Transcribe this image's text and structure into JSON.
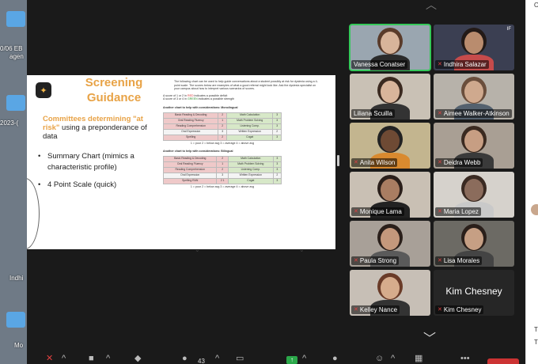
{
  "desktop": {
    "items": [
      {
        "label": "0/06 EB"
      },
      {
        "label": "agen"
      },
      {
        "label": "2023-("
      },
      {
        "label": "Indhi"
      },
      {
        "label": "Mo"
      }
    ]
  },
  "slide": {
    "title": "Screening Guidance",
    "subtitle_highlight": "Committees determining \"at risk\"",
    "subtitle_rest": " using a preponderance of data",
    "bullets": [
      "Summary Chart (mimics a characteristic profile)",
      "4 Point Scale (quick)"
    ],
    "intro": "The following chart can be used to help guide conversations about a student possibly at risk for dyslexia using a 4-point scale. The scores below are examples of what a good referral might look like. Ask the dyslexia specialist on your campus about how to interpret various scenarios of scores.",
    "deficit_prefix": "A score of 1 or 2 in ",
    "deficit_color_word": "RED",
    "deficit_suffix": " indicates a possible deficit",
    "strength_prefix": "A score of 3 or 4 in ",
    "strength_color_word": "GREEN",
    "strength_suffix": " indicates a possible strength",
    "table1_heading": "Another chart to help with considerations: Monolingual",
    "table2_heading": "Another chart to help with considerations: Bilingual",
    "table1": [
      [
        "Basic Reading & Decoding",
        "2",
        "Math Calculation",
        "3"
      ],
      [
        "Oral Reading Fluency",
        "1",
        "Math Problem Solving",
        "3"
      ],
      [
        "Reading Comprehension",
        "2",
        "Listening Comp.",
        "3"
      ],
      [
        "Oral Expression",
        "3",
        "Written Expression",
        "2"
      ],
      [
        "Spelling",
        "2",
        "Cogat",
        "3"
      ]
    ],
    "table2": [
      [
        "Basic Reading & Decoding",
        "2",
        "Math Calculation",
        "3"
      ],
      [
        "Oral Reading Fluency",
        "1",
        "Math Problem Solving",
        "3"
      ],
      [
        "Reading Comprehension",
        "2",
        "Listening Comp.",
        "3"
      ],
      [
        "Oral Expression",
        "3",
        "Written Expression",
        "2"
      ],
      [
        "Spelling RAN",
        "2 1",
        "Cogat",
        "3"
      ]
    ],
    "scale_note": "1 = poor 2 = below avg 3 = average 4 = above avg"
  },
  "participants": [
    {
      "name": "Vanessa Conatser",
      "muted": false,
      "active": true
    },
    {
      "name": "Indhira Salazar",
      "muted": true,
      "active": false,
      "mark": "IF"
    },
    {
      "name": "Liliana Scuilla",
      "muted": false,
      "active": false
    },
    {
      "name": "Aimee Walker-Atkinson",
      "muted": true,
      "active": false
    },
    {
      "name": "Anita Wilson",
      "muted": true,
      "active": false
    },
    {
      "name": "Deidra Webb",
      "muted": true,
      "active": false
    },
    {
      "name": "Monique Lama",
      "muted": true,
      "active": false
    },
    {
      "name": "Maria Lopez",
      "muted": true,
      "active": false
    },
    {
      "name": "Paula Strong",
      "muted": true,
      "active": false
    },
    {
      "name": "Lisa Morales",
      "muted": true,
      "active": false
    },
    {
      "name": "Kelley Nance",
      "muted": true,
      "active": false
    },
    {
      "name": "Kim Chesney",
      "muted": true,
      "active": false,
      "display_text": "Kim Chesney"
    }
  ],
  "toolbar": {
    "participant_count": "43"
  },
  "sidebar": {
    "letters": [
      "O",
      "T",
      "T"
    ]
  }
}
